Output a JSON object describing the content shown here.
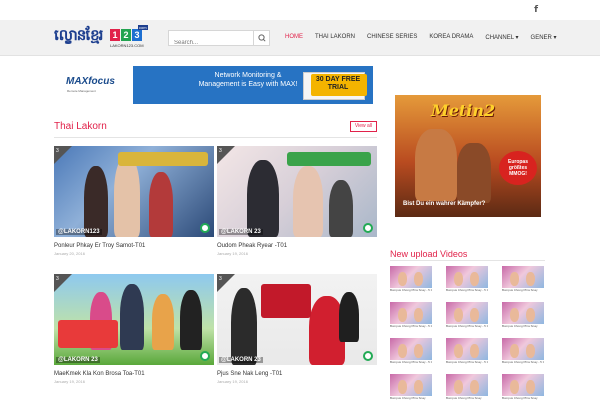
{
  "header": {
    "social_icon": "f",
    "logo": {
      "khmer": "ល្ខោនខ្មែរ",
      "digits": [
        "1",
        "2",
        "3"
      ],
      "badge": "com",
      "subtext": "LAKORN123.COM"
    },
    "search": {
      "placeholder": "Search..."
    },
    "nav": [
      "HOME",
      "THAI LAKORN",
      "CHINESE SERIES",
      "KOREA DRAMA",
      "CHANNEL ▾",
      "GENER ▾"
    ]
  },
  "banner_ad": {
    "brand": "MAXfocus",
    "brand_sub": "Remote Management",
    "message": "Network Monitoring & Management is Easy with MAX!",
    "cta": "30 DAY FREE TRIAL"
  },
  "section": {
    "title": "Thai Lakorn",
    "view_all": "View all"
  },
  "cards": [
    {
      "title": "Ponleur Phkay Er Troy Samot-T01",
      "date": "January 20, 2016",
      "watermark": "@LAKORN123",
      "badge": "3"
    },
    {
      "title": "Oudom Pheak Ryear -T01",
      "date": "January 19, 2016",
      "watermark": "@LAKORN 23",
      "badge": "3"
    },
    {
      "title": "MaeKmek Kla Kon Brosa Toa-T01",
      "date": "January 19, 2016",
      "watermark": "@LAKORN 23",
      "badge": "3"
    },
    {
      "title": "Pjus Sne Nak Leng -T01",
      "date": "January 19, 2016",
      "watermark": "@LAKORN 23",
      "badge": "3"
    }
  ],
  "side_ad": {
    "title": "Metin2",
    "burst": "Europas größtes MMOG!",
    "tagline": "Bist Du ein wahrer Kämpfer?"
  },
  "new_upload": {
    "title": "New upload Videos",
    "items": [
      "Bompus Chong Phra Snay - 5 06 End",
      "Bompus Chong Phra Snay - 5 06",
      "Bompus Chong Phra Snay",
      "Bompus Chong Phra Snay - 5 06",
      "Bompus Chong Phra Snay - 5 06",
      "Bompus Chong Phra Snay",
      "Bompus Chong Phra Snay - 5 06",
      "Bompus Chong Phra Snay - 5 06",
      "Bompus Chong Phra Snay - 5 06",
      "Bompus Chong Phra Snay",
      "Bompus Chong Phra Snay",
      "Bompus Chong Phra Snay"
    ]
  },
  "colors": {
    "accent": "#e1224a",
    "header_bg": "#f1f1f1",
    "ad_blue": "#2773c3"
  }
}
